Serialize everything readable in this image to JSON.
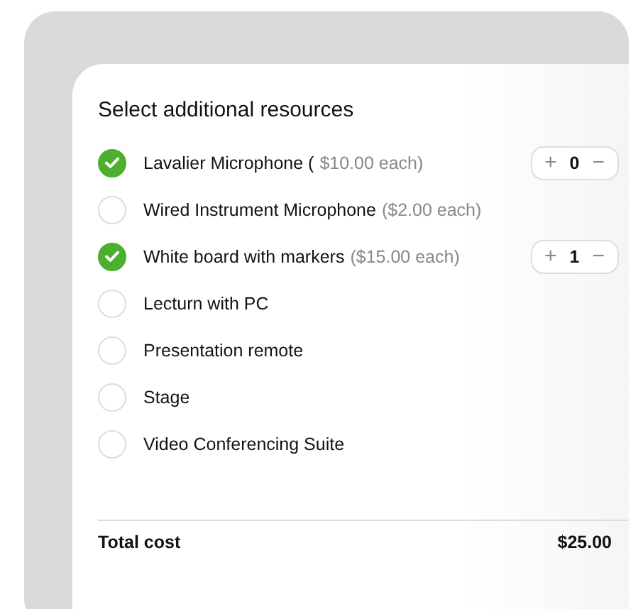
{
  "title": "Select additional resources",
  "resources": [
    {
      "name": "Lavalier Microphone (",
      "price": "$10.00 each)",
      "checked": true,
      "stepper": {
        "plus": "+",
        "count": "0",
        "minus": "−"
      }
    },
    {
      "name": "Wired Instrument Microphone",
      "price": "($2.00 each)",
      "checked": false
    },
    {
      "name": "White board with markers",
      "price": "($15.00 each)",
      "checked": true,
      "stepper": {
        "plus": "+",
        "count": "1",
        "minus": "−"
      }
    },
    {
      "name": "Lecturn with PC",
      "checked": false
    },
    {
      "name": "Presentation remote",
      "checked": false
    },
    {
      "name": "Stage",
      "checked": false
    },
    {
      "name": "Video Conferencing Suite",
      "checked": false
    }
  ],
  "total": {
    "label": "Total cost",
    "value": "$25.00"
  }
}
